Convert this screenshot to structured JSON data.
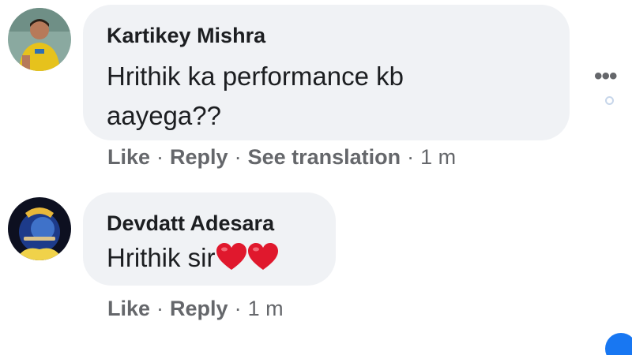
{
  "comments": [
    {
      "author": "Kartikey Mishra",
      "text": "Hrithik ka performance kb aayega??",
      "actions": {
        "like": "Like",
        "reply": "Reply",
        "translate": "See translation",
        "time": "1 m"
      }
    },
    {
      "author": "Devdatt Adesara",
      "text": "Hrithik sir",
      "emojis": [
        "red-heart-icon",
        "red-heart-icon"
      ],
      "actions": {
        "like": "Like",
        "reply": "Reply",
        "time": "1 m"
      }
    }
  ],
  "ui": {
    "more_glyph": "•••",
    "separator": "·"
  },
  "colors": {
    "bubble": "#f0f2f5",
    "text": "#1c1e21",
    "meta": "#65676b",
    "heart": "#e0182d",
    "accent": "#1877f2"
  }
}
